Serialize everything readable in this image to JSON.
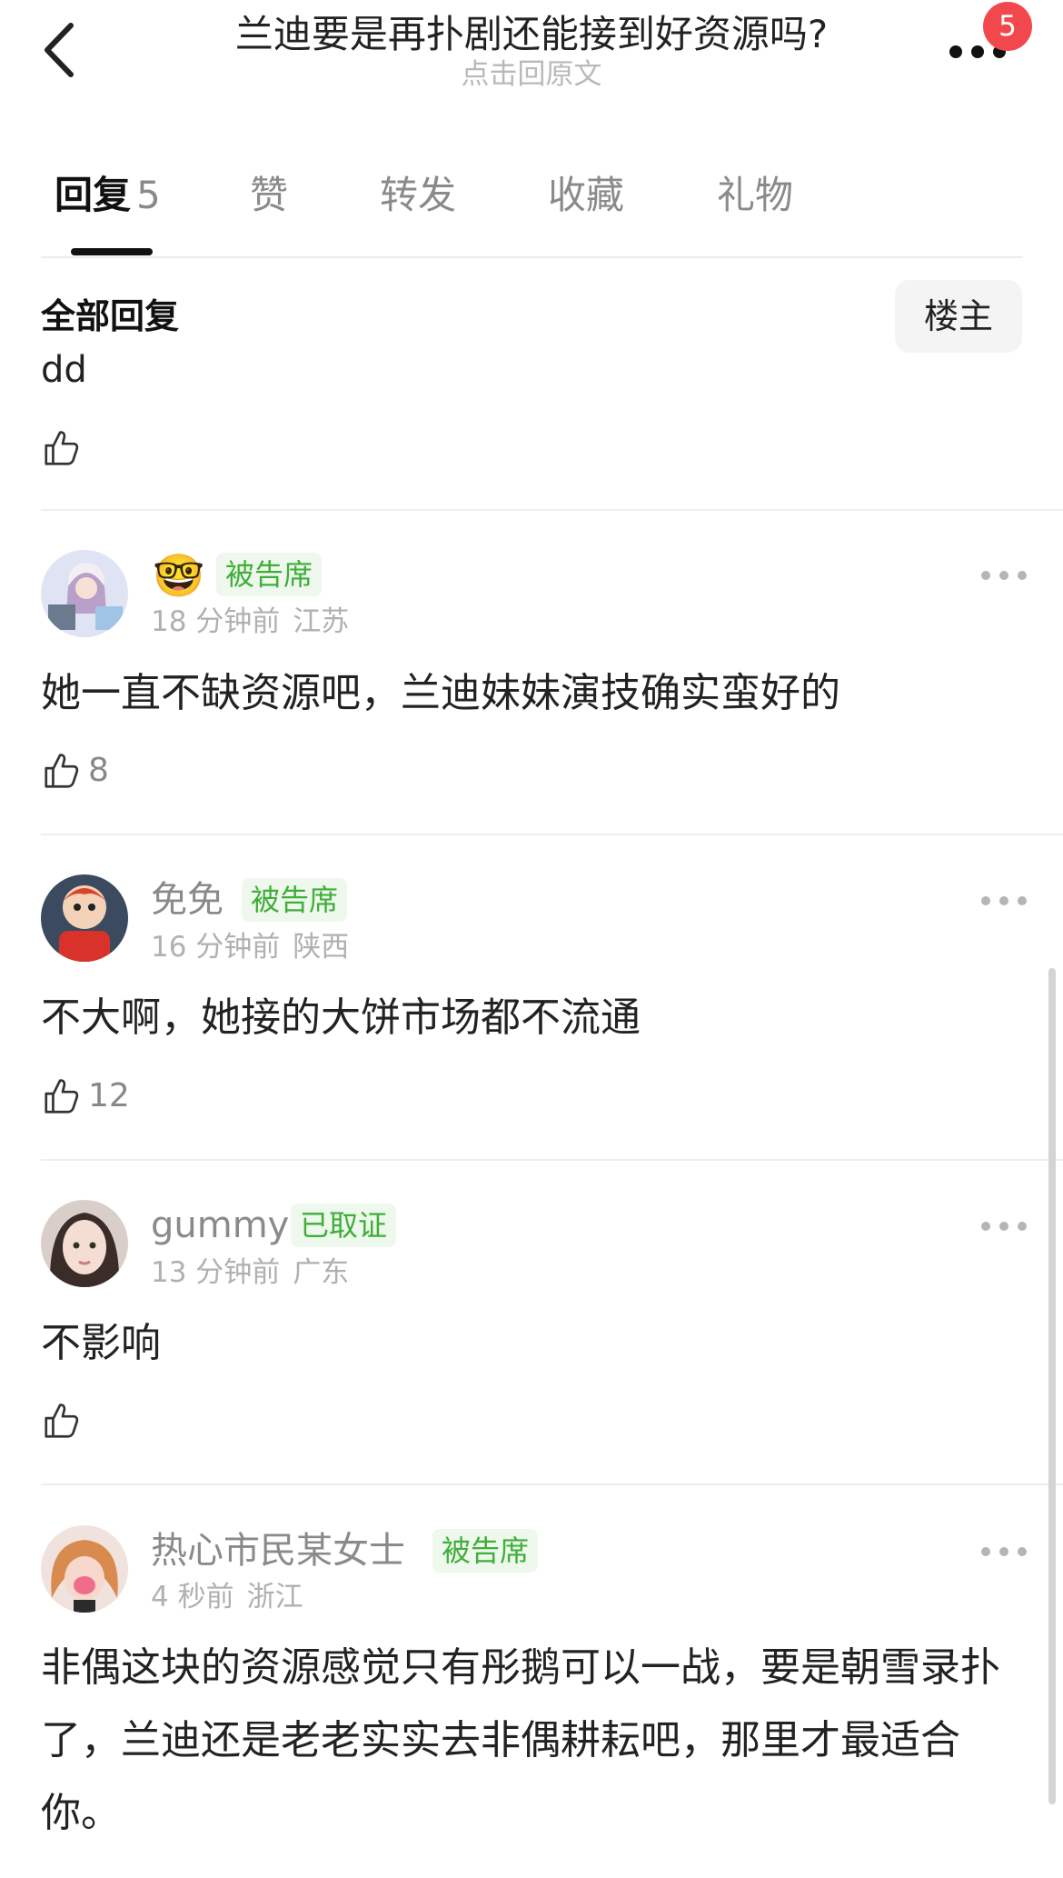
{
  "header": {
    "title": "兰迪要是再扑剧还能接到好资源吗?",
    "subtitle": "点击回原文",
    "notification_count": "5"
  },
  "tabs": [
    {
      "label": "回复",
      "count": "5",
      "active": true
    },
    {
      "label": "赞"
    },
    {
      "label": "转发"
    },
    {
      "label": "收藏"
    },
    {
      "label": "礼物"
    }
  ],
  "filter": {
    "all_label": "全部回复",
    "owner_label": "楼主"
  },
  "partial_comment": {
    "text": "dd"
  },
  "comments": [
    {
      "username": "",
      "emoji": "🤓",
      "tag": "被告席",
      "time": "18 分钟前",
      "location": "江苏",
      "text": "她一直不缺资源吧，兰迪妹妹演技确实蛮好的",
      "likes": "8"
    },
    {
      "username": "免免",
      "tag": "被告席",
      "time": "16 分钟前",
      "location": "陕西",
      "text": "不大啊，她接的大饼市场都不流通",
      "likes": "12"
    },
    {
      "username": "gummy",
      "tag": "已取证",
      "time": "13 分钟前",
      "location": "广东",
      "text": "不影响",
      "likes": ""
    },
    {
      "username": "热心市民某女士",
      "tag": "被告席",
      "time": "4 秒前",
      "location": "浙江",
      "text": "非偶这块的资源感觉只有彤鹅可以一战，要是朝雪录扑了，兰迪还是老老实实去非偶耕耘吧，那里才最适合你。",
      "likes": ""
    }
  ],
  "colors": {
    "badge": "#f2484d",
    "tag_text": "#3fae3a",
    "tag_bg": "#eef8ec",
    "muted": "#8a8a8a"
  }
}
